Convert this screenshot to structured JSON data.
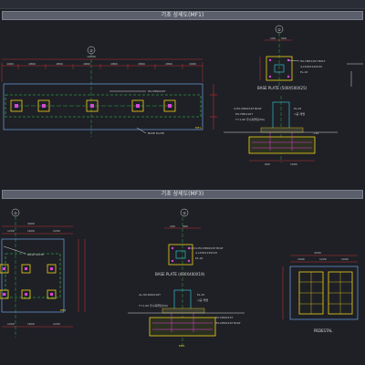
{
  "panels": [
    {
      "header": "기초 상세도(MF1)"
    },
    {
      "header": "기초 상세도(MF3)"
    }
  ],
  "grid_markers": {
    "top_main": "②",
    "top_detail": "①",
    "bottom_left": "①",
    "bottom_mid": "②"
  },
  "top_plan": {
    "overall_dim": "12200",
    "segment_dims": [
      "1000",
      "1800",
      "1800",
      "1800",
      "1800",
      "1800",
      "1800",
      "1000"
    ],
    "labels": [
      "H0-M80X16T",
      "BASE PLATE"
    ],
    "tag": "MF1"
  },
  "top_detail": {
    "dims_top": [
      "100",
      "500"
    ],
    "plate_notes": [
      "H0-H80X16T BOLT",
      "4-L500X120X2X",
      "PL-16"
    ],
    "title": "BASE PLATE (500X500X25)",
    "section_notes": [
      "4-H0-M80X16T BOLT",
      "PL-25",
      "H0-H80X16T",
      "T=1.60 무수축몰탈(50)",
      "시공 레벨"
    ],
    "elev": "+10",
    "dims_bottom": [
      "900",
      "1000"
    ]
  },
  "bottom_plan": {
    "dims_top": [
      "4000",
      "1200",
      "1600",
      "1200"
    ],
    "labels": [
      "BASE PLATE"
    ],
    "tag": "MF3",
    "dims_bottom": [
      "1200",
      "1600",
      "1200"
    ]
  },
  "bottom_detail": {
    "dims_top": [
      "100",
      "400"
    ],
    "plate_notes": [
      "4-H0-M80X16T BOLT",
      "4-L500X120X2X",
      "PL-16"
    ],
    "title": "BASE PLATE (400X400X19)",
    "section_notes": [
      "4L-H0-M20X16T",
      "PL-25",
      "T=1.60 무수축몰탈(50)",
      "시공 레벨"
    ],
    "side_notes": [
      "H0-M80X15T",
      "H0-M80X16T BOLT"
    ],
    "tag": "MF3"
  },
  "pedestal": {
    "dims_top": [
      "3200",
      "1000",
      "1200",
      "1000"
    ],
    "caption": "PEDESTAL"
  }
}
